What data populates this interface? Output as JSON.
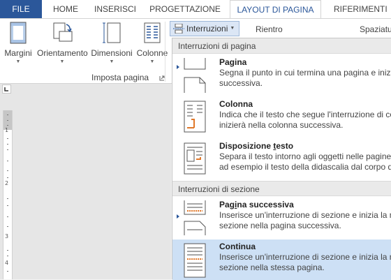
{
  "tabs": {
    "file": "FILE",
    "home": "HOME",
    "inserisci": "INSERISCI",
    "progettazione": "PROGETTAZIONE",
    "layout": "LAYOUT DI PAGINA",
    "riferimenti": "RIFERIMENTI"
  },
  "ribbon": {
    "margini": "Margini",
    "orientamento": "Orientamento",
    "dimensioni": "Dimensioni",
    "colonne": "Colonne",
    "group_label": "Imposta pagina",
    "interruzioni": "Interruzioni",
    "rientro": "Rientro",
    "spaziatura": "Spaziatu"
  },
  "ruler": {
    "numbers": [
      "1",
      "2",
      "3",
      "4"
    ]
  },
  "menu": {
    "section_page": "Interruzioni di pagina",
    "section_section": "Interruzioni di sezione",
    "items": [
      {
        "title": "Pagina",
        "line1": "Segna il punto in cui termina una pagina e inizi",
        "line2": "successiva."
      },
      {
        "title": "Colonna",
        "line1": "Indica che il testo che segue l'interruzione di co",
        "line2": "inizierà nella colonna successiva."
      },
      {
        "title_before": "Disposizione ",
        "title_u": "t",
        "title_after": "esto",
        "line1": "Separa il testo intorno agli oggetti nelle pagine",
        "line2": "ad esempio il testo della didascalia dal corpo d"
      },
      {
        "title_before": "Pag",
        "title_u": "i",
        "title_after": "na successiva",
        "line1": "Inserisce un'interruzione di sezione e inizia la nu",
        "line2": "sezione nella pagina successiva."
      },
      {
        "title": "Continua",
        "line1": "Inserisce un'interruzione di sezione e inizia la nu",
        "line2": "sezione nella stessa pagina."
      }
    ]
  },
  "colors": {
    "file_tab": "#2b579a",
    "accent": "#2b579a",
    "hover": "#cde0f5",
    "orange_icon": "#e0782a"
  }
}
